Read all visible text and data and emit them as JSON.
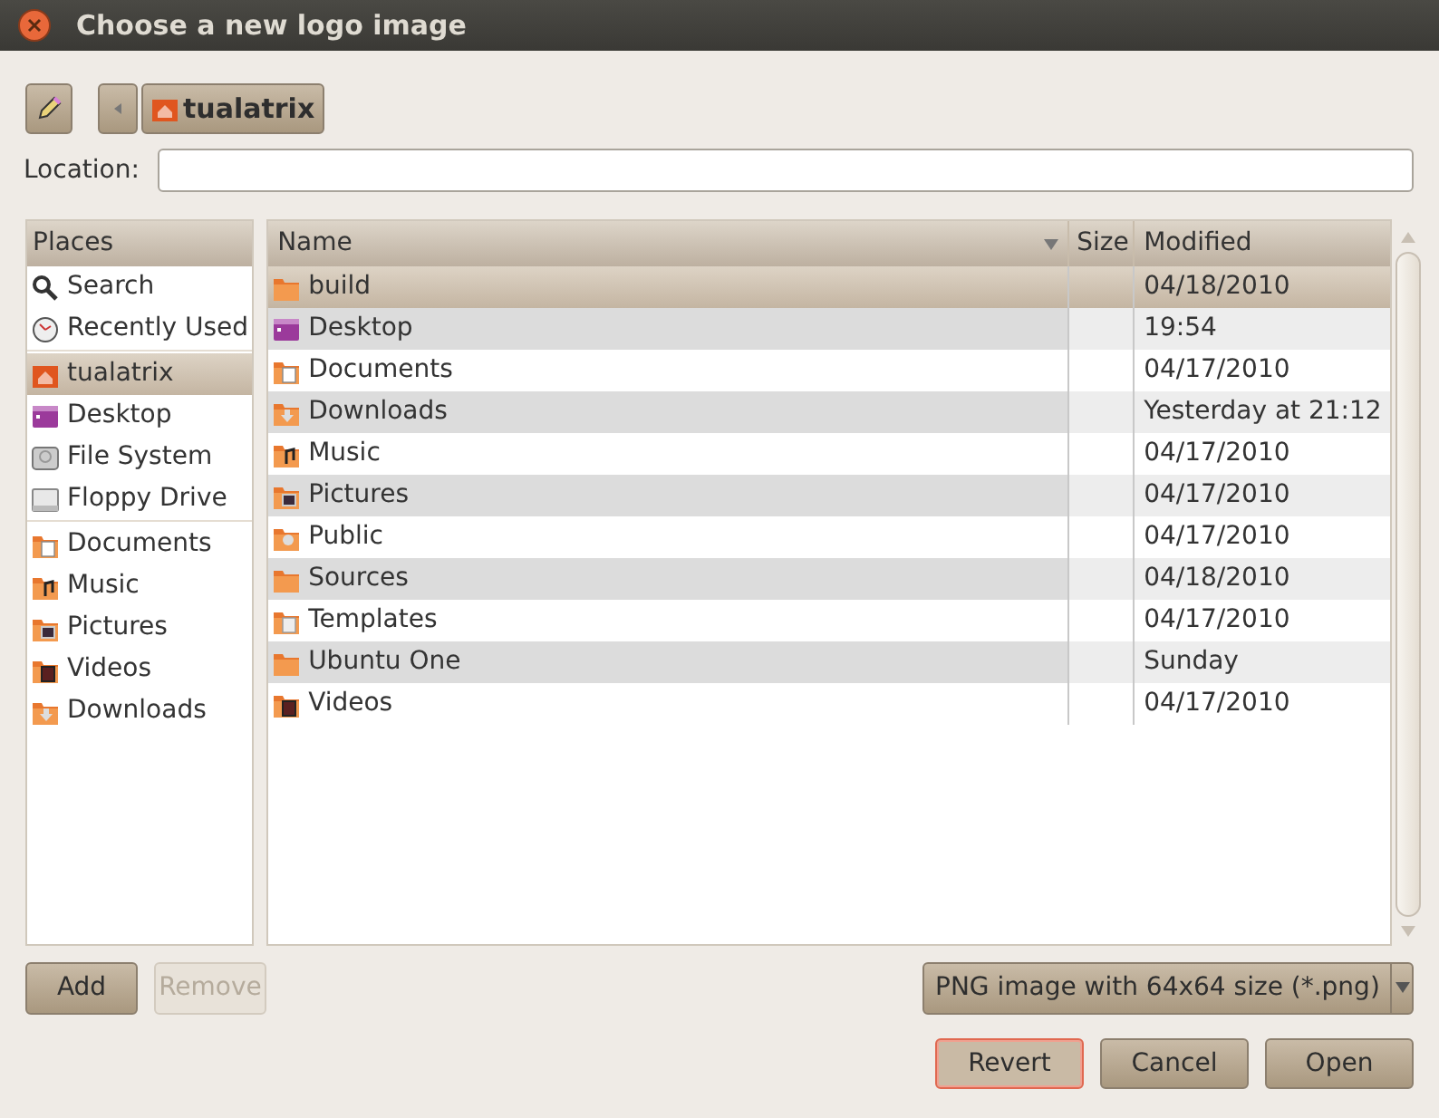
{
  "window": {
    "title": "Choose a new logo image"
  },
  "path_bar": {
    "current": "tualatrix"
  },
  "location": {
    "label": "Location:"
  },
  "places": {
    "heading": "Places",
    "groups": [
      [
        {
          "label": "Search",
          "selected": false
        },
        {
          "label": "Recently Used",
          "selected": false
        }
      ],
      [
        {
          "label": "tualatrix",
          "selected": true
        },
        {
          "label": "Desktop",
          "selected": false
        },
        {
          "label": "File System",
          "selected": false
        },
        {
          "label": "Floppy Drive",
          "selected": false
        }
      ],
      [
        {
          "label": "Documents",
          "selected": false
        },
        {
          "label": "Music",
          "selected": false
        },
        {
          "label": "Pictures",
          "selected": false
        },
        {
          "label": "Videos",
          "selected": false
        },
        {
          "label": "Downloads",
          "selected": false
        }
      ]
    ]
  },
  "table": {
    "columns": [
      "Name",
      "Size",
      "Modified"
    ],
    "rows": [
      {
        "name": "build",
        "modified": "04/18/2010",
        "selected": true
      },
      {
        "name": "Desktop",
        "modified": "19:54",
        "selected": false
      },
      {
        "name": "Documents",
        "modified": "04/17/2010",
        "selected": false
      },
      {
        "name": "Downloads",
        "modified": "Yesterday at 21:12",
        "selected": false
      },
      {
        "name": "Music",
        "modified": "04/17/2010",
        "selected": false
      },
      {
        "name": "Pictures",
        "modified": "04/17/2010",
        "selected": false
      },
      {
        "name": "Public",
        "modified": "04/17/2010",
        "selected": false
      },
      {
        "name": "Sources",
        "modified": "04/18/2010",
        "selected": false
      },
      {
        "name": "Templates",
        "modified": "04/17/2010",
        "selected": false
      },
      {
        "name": "Ubuntu One",
        "modified": "Sunday",
        "selected": false
      },
      {
        "name": "Videos",
        "modified": "04/17/2010",
        "selected": false
      }
    ]
  },
  "places_buttons": [
    {
      "label": "Add",
      "disabled": false
    },
    {
      "label": "Remove",
      "disabled": true
    }
  ],
  "filter": {
    "value": "PNG image with 64x64 size (*.png)"
  },
  "buttons": [
    {
      "label": "Revert",
      "focused": true
    },
    {
      "label": "Cancel",
      "focused": false
    },
    {
      "label": "Open",
      "focused": false
    }
  ]
}
